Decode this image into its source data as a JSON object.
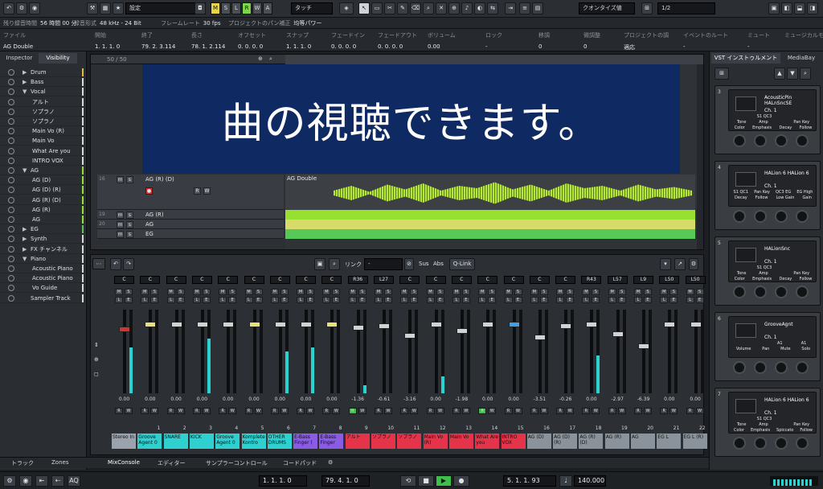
{
  "toolbar": {
    "mode_field": "設定",
    "msrw": [
      "M",
      "S",
      "L",
      "R",
      "W",
      "A"
    ],
    "touch_field": "タッチ",
    "quantize_field": "クオンタイズ値",
    "quantize_value": "1/2"
  },
  "status_line": [
    {
      "label": "残り録音時間",
      "value": "56 時間 00 分"
    },
    {
      "label": "録音形式",
      "value": "48 kHz - 24 Bit"
    },
    {
      "label": "フレームレート",
      "value": "30 fps"
    },
    {
      "label": "プロジェクトのパン補正",
      "value": "均等パワー"
    }
  ],
  "info_line": {
    "track_name": "AG Double",
    "columns": [
      {
        "header": "ファイル",
        "value": ""
      },
      {
        "header": "開始",
        "value": "1. 1. 1. 0"
      },
      {
        "header": "終了",
        "value": "79. 2. 3.114"
      },
      {
        "header": "長さ",
        "value": "78. 1. 2.114"
      },
      {
        "header": "オフセット",
        "value": "0. 0. 0. 0"
      },
      {
        "header": "スナップ",
        "value": "1. 1. 1. 0"
      },
      {
        "header": "フェードイン",
        "value": "0. 0. 0. 0"
      },
      {
        "header": "フェードアウト",
        "value": "0. 0. 0. 0"
      },
      {
        "header": "ボリューム",
        "value": "0.00"
      },
      {
        "header": "ロック",
        "value": "-"
      },
      {
        "header": "移調",
        "value": "0"
      },
      {
        "header": "微調整",
        "value": "0"
      },
      {
        "header": "プロジェクトの調",
        "value": "適応"
      },
      {
        "header": "イベントのルート",
        "value": "-"
      },
      {
        "header": "ミュート",
        "value": "-"
      },
      {
        "header": "ミュージカルモ",
        "value": ""
      }
    ]
  },
  "inspector": {
    "tabs": [
      "Inspector",
      "Visibility"
    ],
    "items": [
      {
        "label": "Drum",
        "indent": 1,
        "tri": "▶",
        "color": "#e8b83a"
      },
      {
        "label": "Bass",
        "indent": 1,
        "tri": "▶",
        "color": "#d9d9d9"
      },
      {
        "label": "Vocal",
        "indent": 1,
        "tri": "▼",
        "color": "#d9d9d9"
      },
      {
        "label": "アルト",
        "indent": 2,
        "tri": "",
        "color": "#d9d9d9"
      },
      {
        "label": "ソプラノ",
        "indent": 2,
        "tri": "",
        "color": "#d9d9d9"
      },
      {
        "label": "ソプラノ",
        "indent": 2,
        "tri": "",
        "color": "#d9d9d9"
      },
      {
        "label": "Main Vo (R)",
        "indent": 2,
        "tri": "",
        "color": "#d9d9d9"
      },
      {
        "label": "Main Vo",
        "indent": 2,
        "tri": "",
        "color": "#d9d9d9"
      },
      {
        "label": "What Are you",
        "indent": 2,
        "tri": "",
        "color": "#d9d9d9"
      },
      {
        "label": "INTRO VOX",
        "indent": 2,
        "tri": "",
        "color": "#d9d9d9"
      },
      {
        "label": "AG",
        "indent": 1,
        "tri": "▼",
        "color": "#98e02f"
      },
      {
        "label": "AG (D)",
        "indent": 2,
        "tri": "",
        "color": "#98e02f"
      },
      {
        "label": "AG (D) (R)",
        "indent": 2,
        "tri": "",
        "color": "#98e02f"
      },
      {
        "label": "AG (R) (D)",
        "indent": 2,
        "tri": "",
        "color": "#98e02f"
      },
      {
        "label": "AG (R)",
        "indent": 2,
        "tri": "",
        "color": "#98e02f"
      },
      {
        "label": "AG",
        "indent": 2,
        "tri": "",
        "color": "#98e02f"
      },
      {
        "label": "EG",
        "indent": 1,
        "tri": "▶",
        "color": "#57c957"
      },
      {
        "label": "Synth",
        "indent": 1,
        "tri": "▶",
        "color": "#d9d9d9"
      },
      {
        "label": "FX チャンネル",
        "indent": 1,
        "tri": "▶",
        "color": "#d9d9d9"
      },
      {
        "label": "Piano",
        "indent": 1,
        "tri": "▼",
        "color": "#d9d9d9"
      },
      {
        "label": "Acoustic Piano",
        "indent": 2,
        "tri": "",
        "color": "#d9d9d9"
      },
      {
        "label": "Acoustic Piano",
        "indent": 2,
        "tri": "",
        "color": "#d9d9d9"
      },
      {
        "label": "Vo Guide",
        "indent": 2,
        "tri": "",
        "color": "#d9d9d9"
      },
      {
        "label": "Sampler Track",
        "indent": 1,
        "tri": "",
        "color": "#d9d9d9"
      }
    ]
  },
  "project": {
    "counter": "50 / 50",
    "tracks": [
      {
        "num": "16",
        "name": "AG (R) (D)",
        "event": "AG Double"
      },
      {
        "num": "19",
        "name": "AG (R)",
        "event": ""
      },
      {
        "num": "20",
        "name": "AG",
        "event": ""
      },
      {
        "num": "",
        "name": "EG",
        "event": ""
      }
    ]
  },
  "banner": {
    "text": "曲の視聴できます。"
  },
  "mixer": {
    "link_label": "リンク",
    "sus_label": "Sus",
    "abs_label": "Abs",
    "qlink_label": "Q-Link",
    "strips": [
      {
        "pan": "C",
        "val": "0.00",
        "ch": "",
        "name": "Stereo In",
        "color": "#9aa3ad",
        "fader": 0.8,
        "cap": "#d23434",
        "meter": 0.55
      },
      {
        "pan": "C",
        "val": "0.00",
        "ch": "1",
        "name": "Groove Agent 0",
        "color": "#2fd0d0",
        "fader": 0.86,
        "cap": "#e8e07a",
        "meter": 0.0
      },
      {
        "pan": "C",
        "val": "0.00",
        "ch": "2",
        "name": "SNARE",
        "color": "#2fd0d0",
        "fader": 0.86,
        "cap": "#cfd3d8",
        "meter": 0.0
      },
      {
        "pan": "C",
        "val": "0.00",
        "ch": "3",
        "name": "KICK",
        "color": "#2fd0d0",
        "fader": 0.86,
        "cap": "#cfd3d8",
        "meter": 0.65
      },
      {
        "pan": "C",
        "val": "0.00",
        "ch": "4",
        "name": "Groove Agent 0",
        "color": "#2fd0d0",
        "fader": 0.86,
        "cap": "#cfd3d8",
        "meter": 0.0
      },
      {
        "pan": "C",
        "val": "0.00",
        "ch": "5",
        "name": "Komplete Kontro",
        "color": "#2fd0d0",
        "fader": 0.86,
        "cap": "#e8e07a",
        "meter": 0.0
      },
      {
        "pan": "C",
        "val": "0.00",
        "ch": "6",
        "name": "OTHER DRUMS",
        "color": "#2fd0d0",
        "fader": 0.86,
        "cap": "#cfd3d8",
        "meter": 0.5
      },
      {
        "pan": "C",
        "val": "0.00",
        "ch": "7",
        "name": "E-Bass Finger (",
        "color": "#8a5be3",
        "fader": 0.86,
        "cap": "#cfd3d8",
        "meter": 0.55
      },
      {
        "pan": "C",
        "val": "0.00",
        "ch": "8",
        "name": "E-Bass Finger",
        "color": "#8a5be3",
        "fader": 0.86,
        "cap": "#e8e07a",
        "meter": 0.0
      },
      {
        "pan": "R36",
        "val": "-1.36",
        "ch": "9",
        "name": "アルト",
        "color": "#e5344a",
        "fader": 0.82,
        "cap": "#cfd3d8",
        "meter": 0.1
      },
      {
        "pan": "L27",
        "val": "-0.61",
        "ch": "10",
        "name": "ソプラノ",
        "color": "#e5344a",
        "fader": 0.84,
        "cap": "#cfd3d8",
        "meter": 0.0
      },
      {
        "pan": "C",
        "val": "-3.16",
        "ch": "11",
        "name": "ソプラノ",
        "color": "#e5344a",
        "fader": 0.72,
        "cap": "#cfd3d8",
        "meter": 0.0
      },
      {
        "pan": "C",
        "val": "0.00",
        "ch": "12",
        "name": "Main Vo (R)",
        "color": "#e5344a",
        "fader": 0.86,
        "cap": "#cfd3d8",
        "meter": 0.2
      },
      {
        "pan": "C",
        "val": "-1.98",
        "ch": "13",
        "name": "Main Vo",
        "color": "#e5344a",
        "fader": 0.78,
        "cap": "#cfd3d8",
        "meter": 0.0
      },
      {
        "pan": "C",
        "val": "0.00",
        "ch": "14",
        "name": "What Are you",
        "color": "#e5344a",
        "fader": 0.86,
        "cap": "#cfd3d8",
        "meter": 0.0
      },
      {
        "pan": "C",
        "val": "0.00",
        "ch": "15",
        "name": "INTRO VOX",
        "color": "#e5344a",
        "fader": 0.86,
        "cap": "#3fa0e8",
        "meter": 0.0
      },
      {
        "pan": "C",
        "val": "-3.51",
        "ch": "16",
        "name": "AG (D)",
        "color": "#8a939c",
        "fader": 0.7,
        "cap": "#cfd3d8",
        "meter": 0.0
      },
      {
        "pan": "C",
        "val": "-0.26",
        "ch": "17",
        "name": "AG (D) (R)",
        "color": "#8a939c",
        "fader": 0.84,
        "cap": "#cfd3d8",
        "meter": 0.0
      },
      {
        "pan": "R43",
        "val": "0.00",
        "ch": "18",
        "name": "AG (R) (D)",
        "color": "#8a939c",
        "fader": 0.86,
        "cap": "#cfd3d8",
        "meter": 0.45
      },
      {
        "pan": "L57",
        "val": "-2.97",
        "ch": "19",
        "name": "AG (R)",
        "color": "#8a939c",
        "fader": 0.74,
        "cap": "#cfd3d8",
        "meter": 0.0
      },
      {
        "pan": "L9",
        "val": "-6.39",
        "ch": "20",
        "name": "AG",
        "color": "#8a939c",
        "fader": 0.6,
        "cap": "#cfd3d8",
        "meter": 0.0
      },
      {
        "pan": "L50",
        "val": "0.00",
        "ch": "21",
        "name": "EG L",
        "color": "#8a939c",
        "fader": 0.86,
        "cap": "#cfd3d8",
        "meter": 0.0
      },
      {
        "pan": "L50",
        "val": "0.00",
        "ch": "22",
        "name": "EG L (R)",
        "color": "#8a939c",
        "fader": 0.86,
        "cap": "#cfd3d8",
        "meter": 0.0
      }
    ]
  },
  "bottom_tabs": [
    "トラック",
    "Zones",
    "MixConsole",
    "エディター",
    "サンプラーコントロール",
    "コードパッド"
  ],
  "transport": {
    "left_pos": "1. 1. 1. 0",
    "right_pos": "79. 4. 1. 0",
    "main_pos": "5. 1. 1. 93",
    "tempo": "140.000"
  },
  "vst": {
    "tabs": [
      "VST インストゥルメント",
      "MediaBay"
    ],
    "racks": [
      {
        "num": "3",
        "name": "AcousticPin HALnSncSE",
        "ch": "Ch. 1",
        "l1": [
          "",
          "S1 QC3",
          "",
          ""
        ],
        "l2": [
          "Tone",
          "Amp",
          "",
          "Pan Key"
        ],
        "l3": [
          "Color",
          "Emphasis",
          "Decay",
          "Follow"
        ]
      },
      {
        "num": "4",
        "name": "HALion 6 HALion 6",
        "ch": "Ch. 1",
        "l1": [
          "S1 QC1",
          "Pan Key",
          "QC3 EG",
          "EG High"
        ],
        "l2": [
          "Decay",
          "Follow",
          "Low Gain",
          "Gain"
        ],
        "l3": [
          "",
          "",
          "",
          ""
        ]
      },
      {
        "num": "5",
        "name": "HALionSnc",
        "ch": "Ch. 1",
        "l1": [
          "",
          "S1 QC3",
          "",
          ""
        ],
        "l2": [
          "Tone",
          "Amp",
          "",
          "Pan Key"
        ],
        "l3": [
          "Color",
          "Emphasis",
          "Decay",
          "Follow"
        ]
      },
      {
        "num": "6",
        "name": "GrooveAgnt",
        "ch": "Ch. 1",
        "l1": [
          "",
          "",
          "A1",
          "A1"
        ],
        "l2": [
          "Volume",
          "Pan",
          "Mute",
          "Solo"
        ],
        "l3": [
          "",
          "",
          "",
          ""
        ]
      },
      {
        "num": "7",
        "name": "HALion 6 HALion 6",
        "ch": "Ch. 1",
        "l1": [
          "",
          "S1 QC3",
          "",
          ""
        ],
        "l2": [
          "Tone",
          "Amp",
          "",
          "Pan Key"
        ],
        "l3": [
          "Color",
          "Emphasis",
          "Spiccato",
          "Follow"
        ]
      }
    ]
  }
}
